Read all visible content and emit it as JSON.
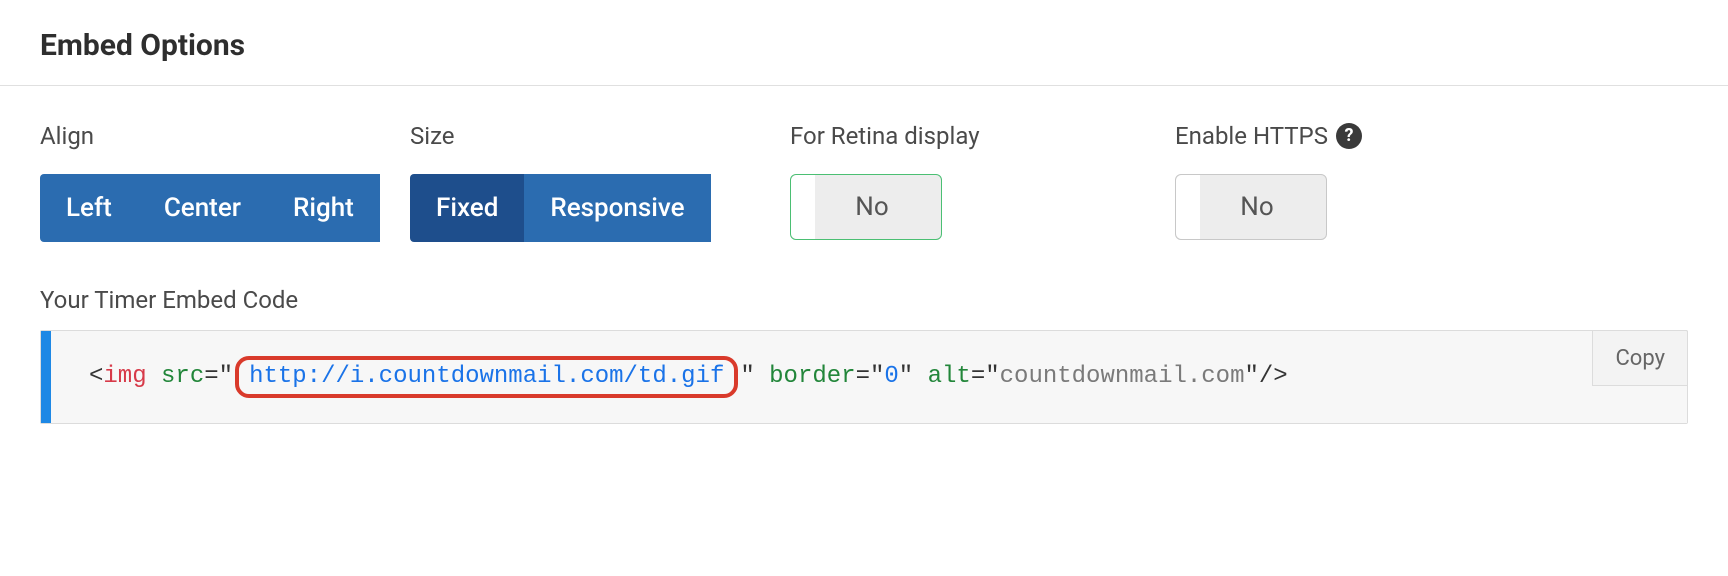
{
  "title": "Embed Options",
  "options": {
    "align": {
      "label": "Align",
      "items": [
        "Left",
        "Center",
        "Right"
      ],
      "selected": null
    },
    "size": {
      "label": "Size",
      "items": [
        "Fixed",
        "Responsive"
      ],
      "selected": "Fixed"
    },
    "retina": {
      "label": "For Retina display",
      "value": "No"
    },
    "https": {
      "label": "Enable HTTPS",
      "value": "No",
      "help_icon": "?"
    }
  },
  "embed": {
    "label": "Your Timer Embed Code",
    "copy_label": "Copy",
    "code": {
      "lt1": "<",
      "tag": "img",
      "sp": " ",
      "attr_src": "src",
      "eq": "=",
      "q": "\"",
      "url": "http://i.countdownmail.com/td.gif",
      "attr_border": "border",
      "val_border": "0",
      "attr_alt": "alt",
      "val_alt": "countdownmail.com",
      "close": "/>"
    }
  }
}
